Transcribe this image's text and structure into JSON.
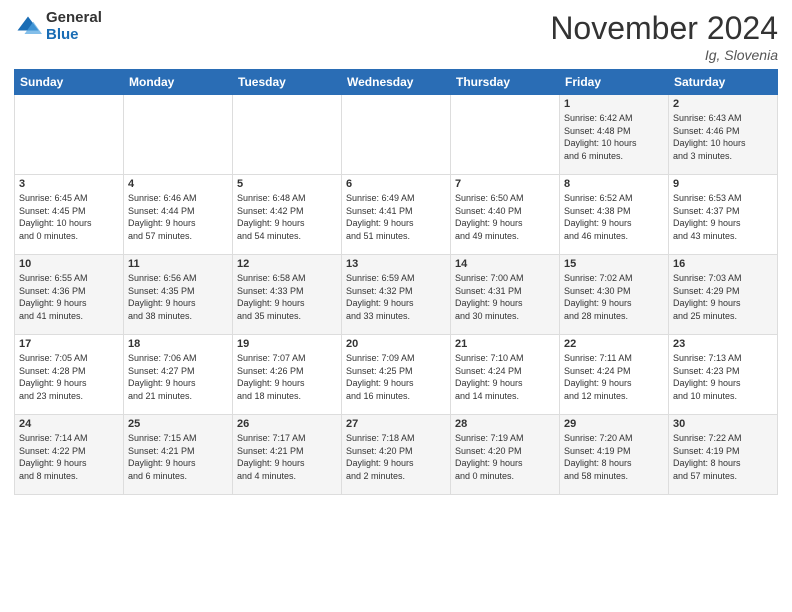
{
  "header": {
    "logo_general": "General",
    "logo_blue": "Blue",
    "title": "November 2024",
    "location": "Ig, Slovenia"
  },
  "weekdays": [
    "Sunday",
    "Monday",
    "Tuesday",
    "Wednesday",
    "Thursday",
    "Friday",
    "Saturday"
  ],
  "weeks": [
    [
      {
        "day": "",
        "info": ""
      },
      {
        "day": "",
        "info": ""
      },
      {
        "day": "",
        "info": ""
      },
      {
        "day": "",
        "info": ""
      },
      {
        "day": "",
        "info": ""
      },
      {
        "day": "1",
        "info": "Sunrise: 6:42 AM\nSunset: 4:48 PM\nDaylight: 10 hours\nand 6 minutes."
      },
      {
        "day": "2",
        "info": "Sunrise: 6:43 AM\nSunset: 4:46 PM\nDaylight: 10 hours\nand 3 minutes."
      }
    ],
    [
      {
        "day": "3",
        "info": "Sunrise: 6:45 AM\nSunset: 4:45 PM\nDaylight: 10 hours\nand 0 minutes."
      },
      {
        "day": "4",
        "info": "Sunrise: 6:46 AM\nSunset: 4:44 PM\nDaylight: 9 hours\nand 57 minutes."
      },
      {
        "day": "5",
        "info": "Sunrise: 6:48 AM\nSunset: 4:42 PM\nDaylight: 9 hours\nand 54 minutes."
      },
      {
        "day": "6",
        "info": "Sunrise: 6:49 AM\nSunset: 4:41 PM\nDaylight: 9 hours\nand 51 minutes."
      },
      {
        "day": "7",
        "info": "Sunrise: 6:50 AM\nSunset: 4:40 PM\nDaylight: 9 hours\nand 49 minutes."
      },
      {
        "day": "8",
        "info": "Sunrise: 6:52 AM\nSunset: 4:38 PM\nDaylight: 9 hours\nand 46 minutes."
      },
      {
        "day": "9",
        "info": "Sunrise: 6:53 AM\nSunset: 4:37 PM\nDaylight: 9 hours\nand 43 minutes."
      }
    ],
    [
      {
        "day": "10",
        "info": "Sunrise: 6:55 AM\nSunset: 4:36 PM\nDaylight: 9 hours\nand 41 minutes."
      },
      {
        "day": "11",
        "info": "Sunrise: 6:56 AM\nSunset: 4:35 PM\nDaylight: 9 hours\nand 38 minutes."
      },
      {
        "day": "12",
        "info": "Sunrise: 6:58 AM\nSunset: 4:33 PM\nDaylight: 9 hours\nand 35 minutes."
      },
      {
        "day": "13",
        "info": "Sunrise: 6:59 AM\nSunset: 4:32 PM\nDaylight: 9 hours\nand 33 minutes."
      },
      {
        "day": "14",
        "info": "Sunrise: 7:00 AM\nSunset: 4:31 PM\nDaylight: 9 hours\nand 30 minutes."
      },
      {
        "day": "15",
        "info": "Sunrise: 7:02 AM\nSunset: 4:30 PM\nDaylight: 9 hours\nand 28 minutes."
      },
      {
        "day": "16",
        "info": "Sunrise: 7:03 AM\nSunset: 4:29 PM\nDaylight: 9 hours\nand 25 minutes."
      }
    ],
    [
      {
        "day": "17",
        "info": "Sunrise: 7:05 AM\nSunset: 4:28 PM\nDaylight: 9 hours\nand 23 minutes."
      },
      {
        "day": "18",
        "info": "Sunrise: 7:06 AM\nSunset: 4:27 PM\nDaylight: 9 hours\nand 21 minutes."
      },
      {
        "day": "19",
        "info": "Sunrise: 7:07 AM\nSunset: 4:26 PM\nDaylight: 9 hours\nand 18 minutes."
      },
      {
        "day": "20",
        "info": "Sunrise: 7:09 AM\nSunset: 4:25 PM\nDaylight: 9 hours\nand 16 minutes."
      },
      {
        "day": "21",
        "info": "Sunrise: 7:10 AM\nSunset: 4:24 PM\nDaylight: 9 hours\nand 14 minutes."
      },
      {
        "day": "22",
        "info": "Sunrise: 7:11 AM\nSunset: 4:24 PM\nDaylight: 9 hours\nand 12 minutes."
      },
      {
        "day": "23",
        "info": "Sunrise: 7:13 AM\nSunset: 4:23 PM\nDaylight: 9 hours\nand 10 minutes."
      }
    ],
    [
      {
        "day": "24",
        "info": "Sunrise: 7:14 AM\nSunset: 4:22 PM\nDaylight: 9 hours\nand 8 minutes."
      },
      {
        "day": "25",
        "info": "Sunrise: 7:15 AM\nSunset: 4:21 PM\nDaylight: 9 hours\nand 6 minutes."
      },
      {
        "day": "26",
        "info": "Sunrise: 7:17 AM\nSunset: 4:21 PM\nDaylight: 9 hours\nand 4 minutes."
      },
      {
        "day": "27",
        "info": "Sunrise: 7:18 AM\nSunset: 4:20 PM\nDaylight: 9 hours\nand 2 minutes."
      },
      {
        "day": "28",
        "info": "Sunrise: 7:19 AM\nSunset: 4:20 PM\nDaylight: 9 hours\nand 0 minutes."
      },
      {
        "day": "29",
        "info": "Sunrise: 7:20 AM\nSunset: 4:19 PM\nDaylight: 8 hours\nand 58 minutes."
      },
      {
        "day": "30",
        "info": "Sunrise: 7:22 AM\nSunset: 4:19 PM\nDaylight: 8 hours\nand 57 minutes."
      }
    ]
  ]
}
